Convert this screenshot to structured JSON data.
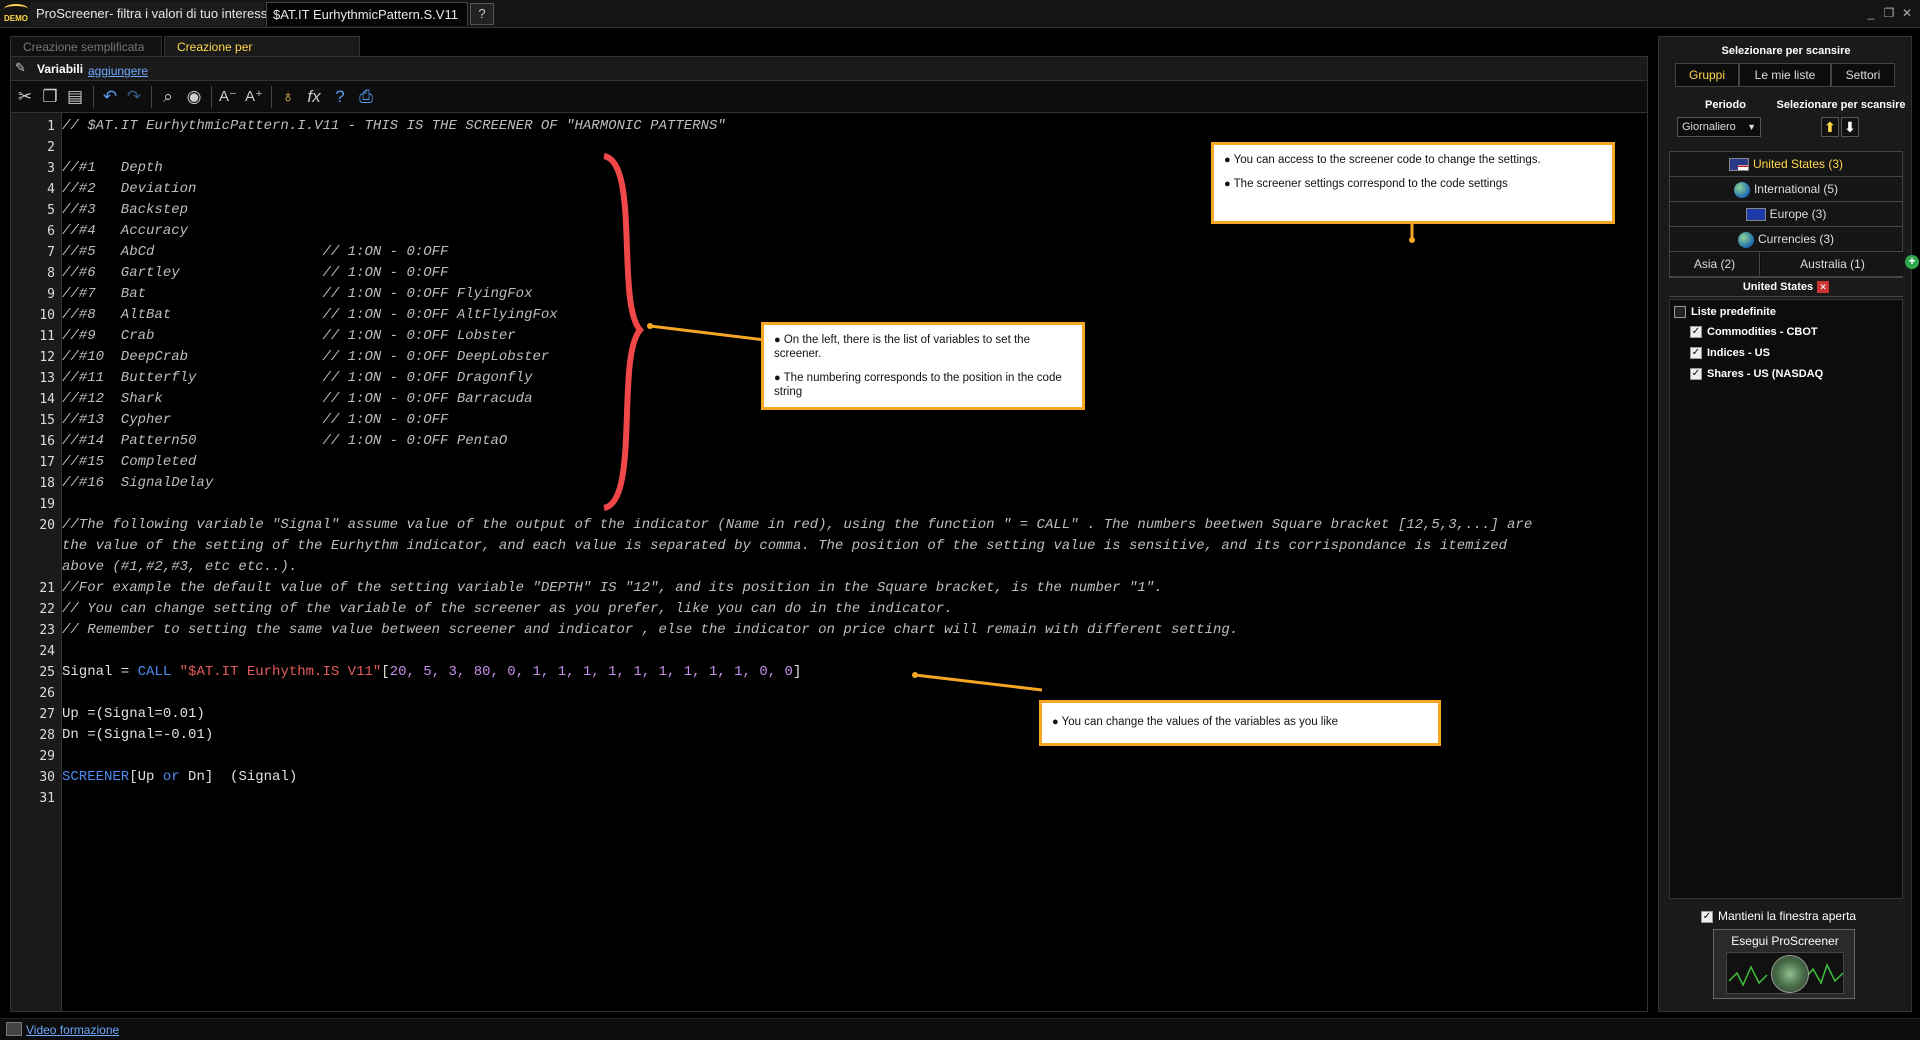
{
  "titlebar": {
    "logo": "DEMO",
    "app_tab": "ProScreener- filtra i valori di tuo interesse",
    "doc_tab": "$AT.IT EurhythmicPattern.S.V11",
    "help_icon": "help-doc-icon",
    "window_buttons": {
      "minimize": "_",
      "restore": "❐",
      "close": "✕"
    }
  },
  "modes": [
    "Creazione semplificata",
    "Creazione per Programmazione"
  ],
  "vars": {
    "title": "Variabili",
    "add_link": "aggiungere"
  },
  "toolbar": {
    "icons": [
      "cut-icon",
      "copy-icon",
      "paste-icon",
      "undo-icon",
      "redo-icon",
      "find-icon",
      "comment-icon",
      "font-decrease-icon",
      "font-increase-icon",
      "idea-icon",
      "function-icon",
      "help-icon",
      "print-icon"
    ]
  },
  "editor": {
    "lines": [
      "// $AT.IT EurhythmicPattern.I.V11 - THIS IS THE SCREENER OF \"HARMONIC PATTERNS\"",
      "",
      "//#1   Depth",
      "//#2   Deviation",
      "//#3   Backstep",
      "//#4   Accuracy",
      "//#5   AbCd                    // 1:ON - 0:OFF",
      "//#6   Gartley                 // 1:ON - 0:OFF",
      "//#7   Bat                     // 1:ON - 0:OFF FlyingFox",
      "//#8   AltBat                  // 1:ON - 0:OFF AltFlyingFox",
      "//#9   Crab                    // 1:ON - 0:OFF Lobster",
      "//#10  DeepCrab                // 1:ON - 0:OFF DeepLobster",
      "//#11  Butterfly               // 1:ON - 0:OFF Dragonfly",
      "//#12  Shark                   // 1:ON - 0:OFF Barracuda",
      "//#13  Cypher                  // 1:ON - 0:OFF",
      "//#14  Pattern50               // 1:ON - 0:OFF PentaO",
      "//#15  Completed",
      "//#16  SignalDelay",
      "",
      "//The following variable \"Signal\" assume value of the output of the indicator (Name in red), using the function \" = CALL\" . The numbers beetwen Square bracket [12,5,3,...] are",
      "the value of the setting of the Eurhythm indicator, and each value is separated by comma. The position of the setting value is sensitive, and its corrispondance is itemized",
      "above (#1,#2,#3, etc etc..).",
      "//For example the default value of the setting variable \"DEPTH\" IS \"12\", and its position in the Square bracket, is the number \"1\".",
      "// You can change setting of the variable of the screener as you prefer, like you can do in the indicator.",
      "// Remember to setting the same value between screener and indicator , else the indicator on price chart will remain with different setting.",
      "",
      "Signal = ",
      "CALL",
      " \"$AT.IT Eurhythm.IS V11\"",
      "[",
      "20, 5, 3, 80, 0, 1, 1, 1, 1, 1, 1, 1, 1, 1, 0, 0",
      "]",
      "",
      "Up =(Signal=0.01)",
      "Dn =(Signal=-0.01)",
      "",
      "SCREENER",
      "[Up ",
      "or",
      " Dn]  (Signal)"
    ],
    "line_numbers": [
      "1",
      "2",
      "3",
      "4",
      "5",
      "6",
      "7",
      "8",
      "9",
      "10",
      "11",
      "12",
      "13",
      "14",
      "15",
      "16",
      "17",
      "18",
      "19",
      "20",
      "21",
      "22",
      "23",
      "24",
      "25",
      "26",
      "27",
      "28",
      "29",
      "30",
      "31"
    ]
  },
  "callouts": {
    "top_right": [
      "You can access to the screener code to change the settings.",
      "The screener settings correspond to the code settings"
    ],
    "middle": [
      "On the left, there is the list of variables to set the screener.",
      "The numbering corresponds to the position in the code string"
    ],
    "bottom": [
      "You can change the values of the variables as you like"
    ],
    "bullet": "●"
  },
  "right_panel": {
    "title": "Selezionare per scansire",
    "segments": [
      "Gruppi",
      "Le mie liste",
      "Settori"
    ],
    "periodo_label": "Periodo",
    "scan_label": "Selezionare per scansire",
    "period_value": "Giornaliero",
    "up_arrow": "⬆",
    "down_arrow": "⬇",
    "groups": [
      {
        "label": "United States (3)",
        "icon": "us-flag-icon"
      },
      {
        "label": "International (5)",
        "icon": "globe-icon"
      },
      {
        "label": "Europe (3)",
        "icon": "eu-flag-icon"
      },
      {
        "label": "Currencies (3)",
        "icon": "globe-icon"
      }
    ],
    "asia": "Asia (2)",
    "australia": "Australia (1)",
    "add": "+",
    "selected_group": "United States",
    "remove": "✕",
    "lists_header": "Liste predefinite",
    "lists": [
      "Commodities - CBOT",
      "Indices - US",
      "Shares - US (NASDAQ"
    ],
    "check": "✓",
    "keep_open": "Mantieni la finestra aperta",
    "run_button": "Esegui ProScreener"
  },
  "bottom": {
    "video_link": "Video formazione"
  },
  "colors": {
    "accent": "#ffd84a",
    "callout_border": "#f5a623",
    "brace": "#f04848",
    "link": "#6fa8ff"
  }
}
